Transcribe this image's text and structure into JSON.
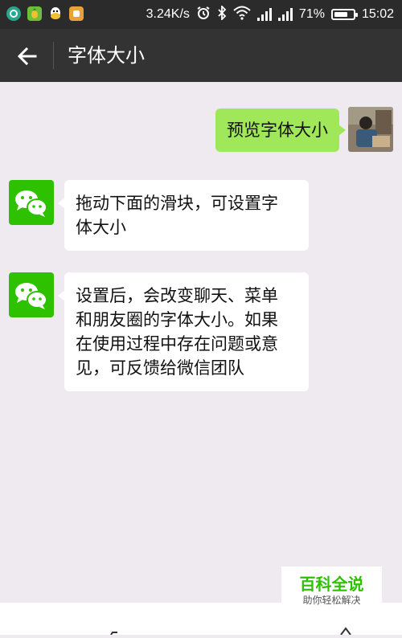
{
  "status_bar": {
    "speed": "3.24K/s",
    "battery": "71%",
    "battery_level": 0.71,
    "time": "15:02"
  },
  "header": {
    "title": "字体大小"
  },
  "messages": [
    {
      "side": "right",
      "text": "预览字体大小"
    },
    {
      "side": "left",
      "text_lines": [
        "拖动下面的滑块，可设置字",
        "体大小"
      ]
    },
    {
      "side": "left",
      "text_lines": [
        "设置后，会改变聊天、菜单",
        "和朋友圈的字体大小。如果",
        "在使用过程中存在问题或意",
        "见，可反馈给微信团队"
      ]
    }
  ],
  "watermark": {
    "main": "百科全说",
    "sub": "助你轻松解决"
  },
  "colors": {
    "header_bg": "#333333",
    "status_bg": "#2b2b2b",
    "chat_bg": "#efeaef",
    "sent_bubble": "#a0e75a",
    "wechat_green": "#2dc100"
  }
}
